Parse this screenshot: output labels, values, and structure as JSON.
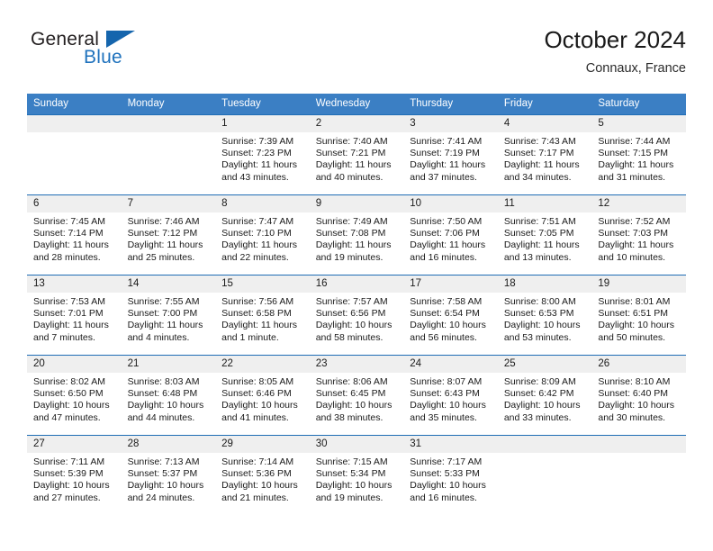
{
  "brand": {
    "line1": "General",
    "line2": "Blue",
    "triangle_icon": "triangle-icon",
    "color_dark": "#231f20",
    "color_blue": "#1f72bd"
  },
  "header": {
    "title": "October 2024",
    "location": "Connaux, France"
  },
  "colors": {
    "header_bar": "#3b7fc4",
    "row_divider": "#1f6db5",
    "daynum_band": "#efefef",
    "text": "#1a1a1a"
  },
  "weekday_headers": [
    "Sunday",
    "Monday",
    "Tuesday",
    "Wednesday",
    "Thursday",
    "Friday",
    "Saturday"
  ],
  "labels": {
    "sunrise": "Sunrise:",
    "sunset": "Sunset:",
    "daylight": "Daylight:"
  },
  "weeks": [
    [
      {
        "day": "",
        "sunrise": "",
        "sunset": "",
        "daylight_line1": "",
        "daylight_line2": ""
      },
      {
        "day": "",
        "sunrise": "",
        "sunset": "",
        "daylight_line1": "",
        "daylight_line2": ""
      },
      {
        "day": "1",
        "sunrise": "Sunrise: 7:39 AM",
        "sunset": "Sunset: 7:23 PM",
        "daylight_line1": "Daylight: 11 hours",
        "daylight_line2": "and 43 minutes."
      },
      {
        "day": "2",
        "sunrise": "Sunrise: 7:40 AM",
        "sunset": "Sunset: 7:21 PM",
        "daylight_line1": "Daylight: 11 hours",
        "daylight_line2": "and 40 minutes."
      },
      {
        "day": "3",
        "sunrise": "Sunrise: 7:41 AM",
        "sunset": "Sunset: 7:19 PM",
        "daylight_line1": "Daylight: 11 hours",
        "daylight_line2": "and 37 minutes."
      },
      {
        "day": "4",
        "sunrise": "Sunrise: 7:43 AM",
        "sunset": "Sunset: 7:17 PM",
        "daylight_line1": "Daylight: 11 hours",
        "daylight_line2": "and 34 minutes."
      },
      {
        "day": "5",
        "sunrise": "Sunrise: 7:44 AM",
        "sunset": "Sunset: 7:15 PM",
        "daylight_line1": "Daylight: 11 hours",
        "daylight_line2": "and 31 minutes."
      }
    ],
    [
      {
        "day": "6",
        "sunrise": "Sunrise: 7:45 AM",
        "sunset": "Sunset: 7:14 PM",
        "daylight_line1": "Daylight: 11 hours",
        "daylight_line2": "and 28 minutes."
      },
      {
        "day": "7",
        "sunrise": "Sunrise: 7:46 AM",
        "sunset": "Sunset: 7:12 PM",
        "daylight_line1": "Daylight: 11 hours",
        "daylight_line2": "and 25 minutes."
      },
      {
        "day": "8",
        "sunrise": "Sunrise: 7:47 AM",
        "sunset": "Sunset: 7:10 PM",
        "daylight_line1": "Daylight: 11 hours",
        "daylight_line2": "and 22 minutes."
      },
      {
        "day": "9",
        "sunrise": "Sunrise: 7:49 AM",
        "sunset": "Sunset: 7:08 PM",
        "daylight_line1": "Daylight: 11 hours",
        "daylight_line2": "and 19 minutes."
      },
      {
        "day": "10",
        "sunrise": "Sunrise: 7:50 AM",
        "sunset": "Sunset: 7:06 PM",
        "daylight_line1": "Daylight: 11 hours",
        "daylight_line2": "and 16 minutes."
      },
      {
        "day": "11",
        "sunrise": "Sunrise: 7:51 AM",
        "sunset": "Sunset: 7:05 PM",
        "daylight_line1": "Daylight: 11 hours",
        "daylight_line2": "and 13 minutes."
      },
      {
        "day": "12",
        "sunrise": "Sunrise: 7:52 AM",
        "sunset": "Sunset: 7:03 PM",
        "daylight_line1": "Daylight: 11 hours",
        "daylight_line2": "and 10 minutes."
      }
    ],
    [
      {
        "day": "13",
        "sunrise": "Sunrise: 7:53 AM",
        "sunset": "Sunset: 7:01 PM",
        "daylight_line1": "Daylight: 11 hours",
        "daylight_line2": "and 7 minutes."
      },
      {
        "day": "14",
        "sunrise": "Sunrise: 7:55 AM",
        "sunset": "Sunset: 7:00 PM",
        "daylight_line1": "Daylight: 11 hours",
        "daylight_line2": "and 4 minutes."
      },
      {
        "day": "15",
        "sunrise": "Sunrise: 7:56 AM",
        "sunset": "Sunset: 6:58 PM",
        "daylight_line1": "Daylight: 11 hours",
        "daylight_line2": "and 1 minute."
      },
      {
        "day": "16",
        "sunrise": "Sunrise: 7:57 AM",
        "sunset": "Sunset: 6:56 PM",
        "daylight_line1": "Daylight: 10 hours",
        "daylight_line2": "and 58 minutes."
      },
      {
        "day": "17",
        "sunrise": "Sunrise: 7:58 AM",
        "sunset": "Sunset: 6:54 PM",
        "daylight_line1": "Daylight: 10 hours",
        "daylight_line2": "and 56 minutes."
      },
      {
        "day": "18",
        "sunrise": "Sunrise: 8:00 AM",
        "sunset": "Sunset: 6:53 PM",
        "daylight_line1": "Daylight: 10 hours",
        "daylight_line2": "and 53 minutes."
      },
      {
        "day": "19",
        "sunrise": "Sunrise: 8:01 AM",
        "sunset": "Sunset: 6:51 PM",
        "daylight_line1": "Daylight: 10 hours",
        "daylight_line2": "and 50 minutes."
      }
    ],
    [
      {
        "day": "20",
        "sunrise": "Sunrise: 8:02 AM",
        "sunset": "Sunset: 6:50 PM",
        "daylight_line1": "Daylight: 10 hours",
        "daylight_line2": "and 47 minutes."
      },
      {
        "day": "21",
        "sunrise": "Sunrise: 8:03 AM",
        "sunset": "Sunset: 6:48 PM",
        "daylight_line1": "Daylight: 10 hours",
        "daylight_line2": "and 44 minutes."
      },
      {
        "day": "22",
        "sunrise": "Sunrise: 8:05 AM",
        "sunset": "Sunset: 6:46 PM",
        "daylight_line1": "Daylight: 10 hours",
        "daylight_line2": "and 41 minutes."
      },
      {
        "day": "23",
        "sunrise": "Sunrise: 8:06 AM",
        "sunset": "Sunset: 6:45 PM",
        "daylight_line1": "Daylight: 10 hours",
        "daylight_line2": "and 38 minutes."
      },
      {
        "day": "24",
        "sunrise": "Sunrise: 8:07 AM",
        "sunset": "Sunset: 6:43 PM",
        "daylight_line1": "Daylight: 10 hours",
        "daylight_line2": "and 35 minutes."
      },
      {
        "day": "25",
        "sunrise": "Sunrise: 8:09 AM",
        "sunset": "Sunset: 6:42 PM",
        "daylight_line1": "Daylight: 10 hours",
        "daylight_line2": "and 33 minutes."
      },
      {
        "day": "26",
        "sunrise": "Sunrise: 8:10 AM",
        "sunset": "Sunset: 6:40 PM",
        "daylight_line1": "Daylight: 10 hours",
        "daylight_line2": "and 30 minutes."
      }
    ],
    [
      {
        "day": "27",
        "sunrise": "Sunrise: 7:11 AM",
        "sunset": "Sunset: 5:39 PM",
        "daylight_line1": "Daylight: 10 hours",
        "daylight_line2": "and 27 minutes."
      },
      {
        "day": "28",
        "sunrise": "Sunrise: 7:13 AM",
        "sunset": "Sunset: 5:37 PM",
        "daylight_line1": "Daylight: 10 hours",
        "daylight_line2": "and 24 minutes."
      },
      {
        "day": "29",
        "sunrise": "Sunrise: 7:14 AM",
        "sunset": "Sunset: 5:36 PM",
        "daylight_line1": "Daylight: 10 hours",
        "daylight_line2": "and 21 minutes."
      },
      {
        "day": "30",
        "sunrise": "Sunrise: 7:15 AM",
        "sunset": "Sunset: 5:34 PM",
        "daylight_line1": "Daylight: 10 hours",
        "daylight_line2": "and 19 minutes."
      },
      {
        "day": "31",
        "sunrise": "Sunrise: 7:17 AM",
        "sunset": "Sunset: 5:33 PM",
        "daylight_line1": "Daylight: 10 hours",
        "daylight_line2": "and 16 minutes."
      },
      {
        "day": "",
        "sunrise": "",
        "sunset": "",
        "daylight_line1": "",
        "daylight_line2": ""
      },
      {
        "day": "",
        "sunrise": "",
        "sunset": "",
        "daylight_line1": "",
        "daylight_line2": ""
      }
    ]
  ]
}
